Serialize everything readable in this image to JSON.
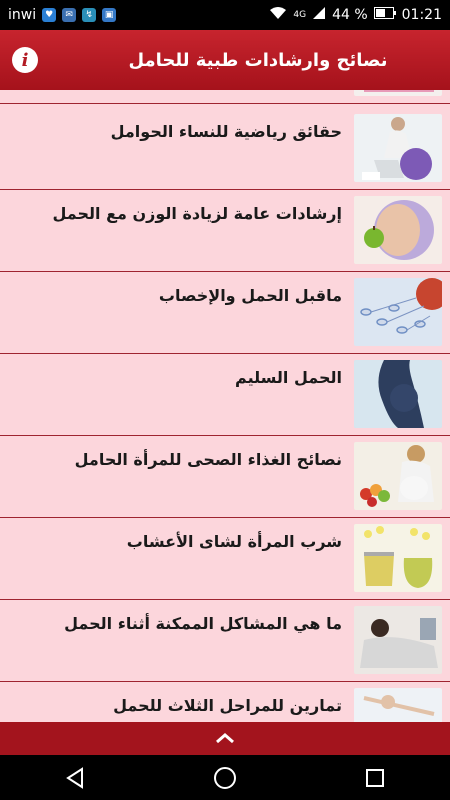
{
  "status": {
    "carrier": "inwi",
    "network": "4G",
    "battery": "44 %",
    "time": "01:21"
  },
  "appbar": {
    "title": "نصائح وارشادات طبية للحامل",
    "info_glyph": "i"
  },
  "list": {
    "items": [
      {
        "label": "حقائق رياضية للنساء الحوامل"
      },
      {
        "label": "إرشادات عامة لزيادة الوزن مع الحمل"
      },
      {
        "label": "ماقبل الحمل والإخصاب"
      },
      {
        "label": "الحمل السليم"
      },
      {
        "label": "نصائح الغذاء الصحى للمرأة الحامل"
      },
      {
        "label": "شرب المرأة لشاى الأعشاب"
      },
      {
        "label": "ما هي المشاكل الممكنة أثناء الحمل"
      },
      {
        "label": "تمارين للمراحل الثلاث للحمل"
      }
    ]
  },
  "bottombar": {
    "glyph": "⌃"
  },
  "colors": {
    "accent": "#b21b24",
    "background": "#fcd6dc"
  }
}
